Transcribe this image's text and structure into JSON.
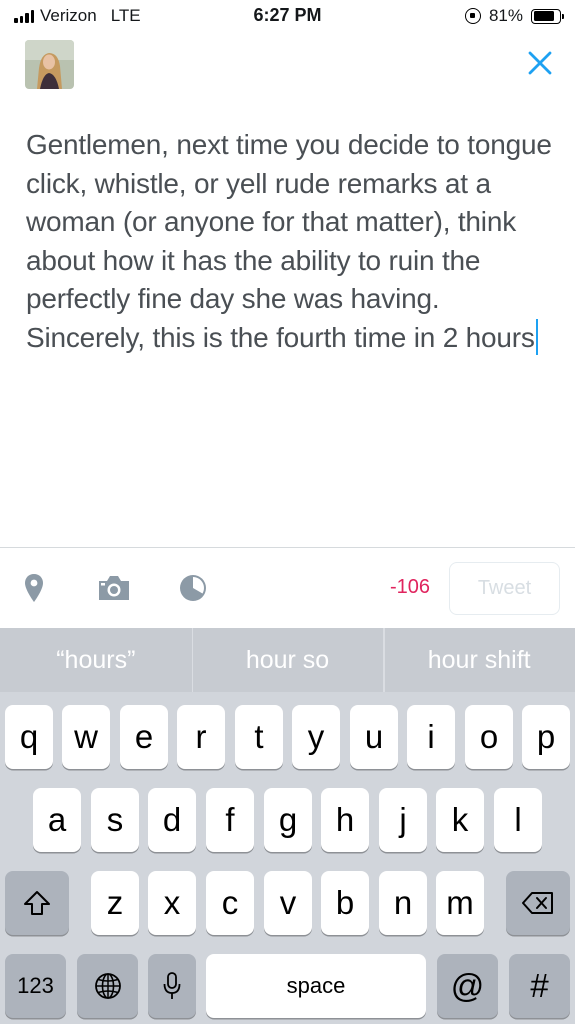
{
  "status_bar": {
    "carrier": "Verizon",
    "network": "LTE",
    "time": "6:27 PM",
    "battery": "81%",
    "battery_level": 0.81
  },
  "compose": {
    "tweet_text": "Gentlemen, next time you decide to tongue click, whistle, or yell rude remarks at a woman (or anyone for that matter), think about how it has the ability to ruin the perfectly fine day she was having. Sincerely, this is the fourth time in 2 hours",
    "icons": [
      "location-pin-icon",
      "camera-icon",
      "poll-icon"
    ],
    "char_counter": "-106",
    "tweet_button_label": "Tweet",
    "accent_color": "#1da1f2",
    "counter_color": "#e0245e"
  },
  "keyboard": {
    "suggestions": [
      "“hours”",
      "hour so",
      "hour shift"
    ],
    "row1": [
      "q",
      "w",
      "e",
      "r",
      "t",
      "y",
      "u",
      "i",
      "o",
      "p"
    ],
    "row2": [
      "a",
      "s",
      "d",
      "f",
      "g",
      "h",
      "j",
      "k",
      "l"
    ],
    "row3": [
      "z",
      "x",
      "c",
      "v",
      "b",
      "n",
      "m"
    ],
    "numbers_key": "123",
    "space_key": "space",
    "at_key": "@",
    "hash_key": "#"
  }
}
